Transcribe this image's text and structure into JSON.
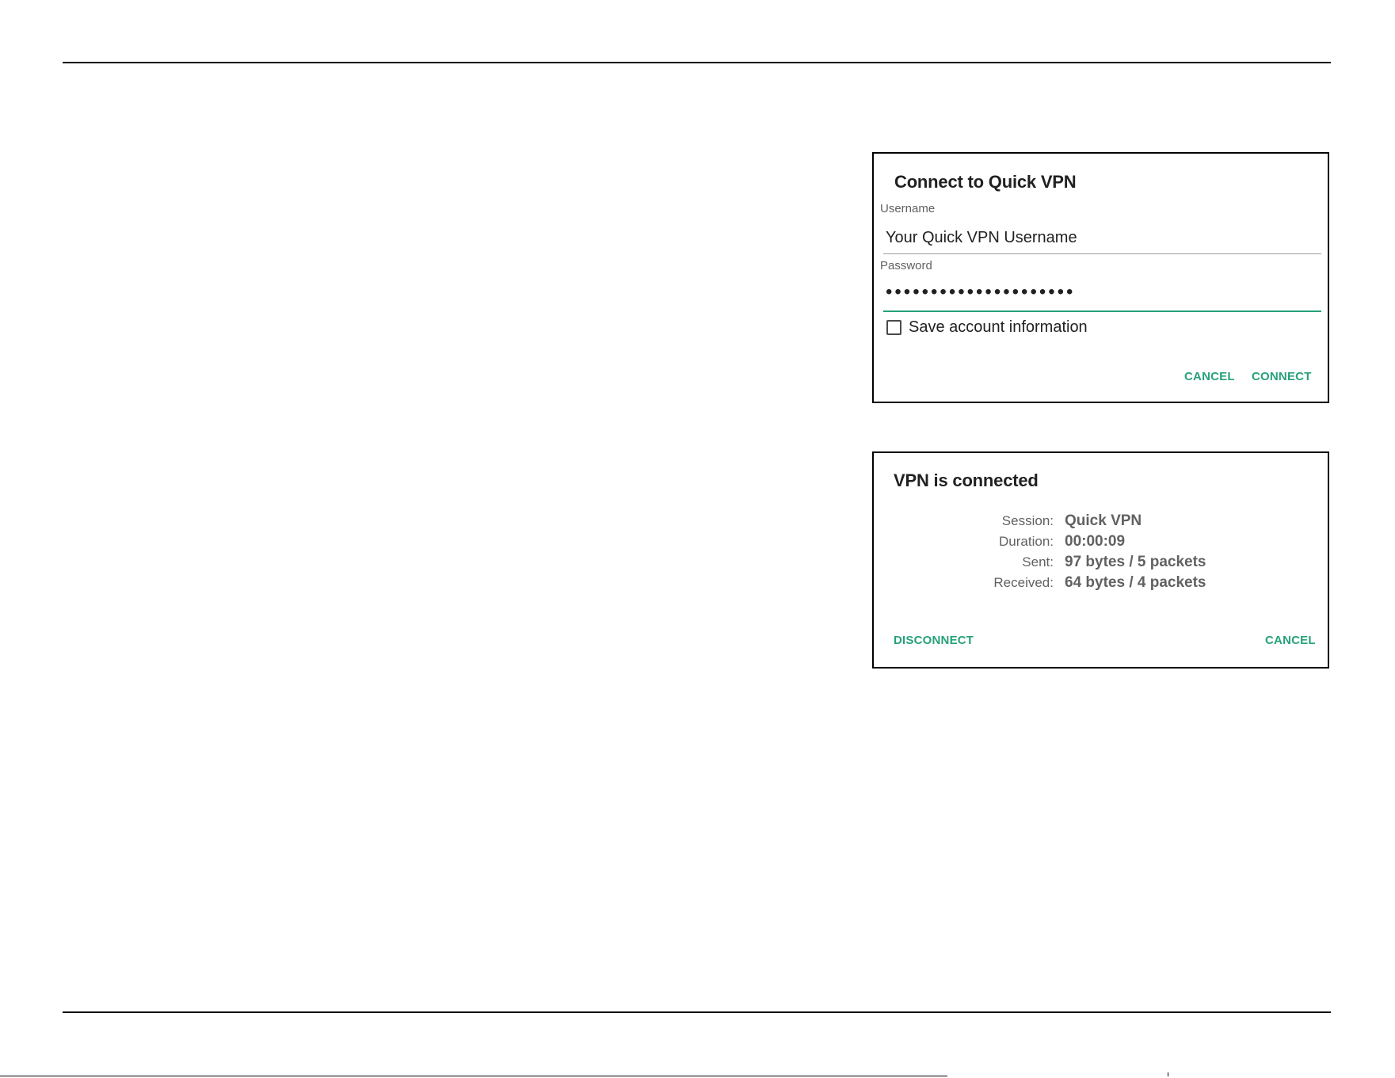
{
  "login_dialog": {
    "title": "Connect to Quick VPN",
    "username_label": "Username",
    "username_value": "Your Quick VPN Username",
    "password_label": "Password",
    "password_value": "•••••••••••••••••••••",
    "save_account_label": "Save account information",
    "save_account_checked": false,
    "cancel_label": "CANCEL",
    "connect_label": "CONNECT"
  },
  "status_dialog": {
    "title": "VPN is connected",
    "rows": [
      {
        "key": "Session:",
        "value": "Quick VPN"
      },
      {
        "key": "Duration:",
        "value": "00:00:09"
      },
      {
        "key": "Sent:",
        "value": "97 bytes / 5 packets"
      },
      {
        "key": "Received:",
        "value": "64 bytes / 4 packets"
      }
    ],
    "disconnect_label": "DISCONNECT",
    "cancel_label": "CANCEL"
  },
  "colors": {
    "accent": "#26a17b",
    "text_primary": "#212121",
    "text_secondary": "#616161",
    "border": "#000000"
  }
}
